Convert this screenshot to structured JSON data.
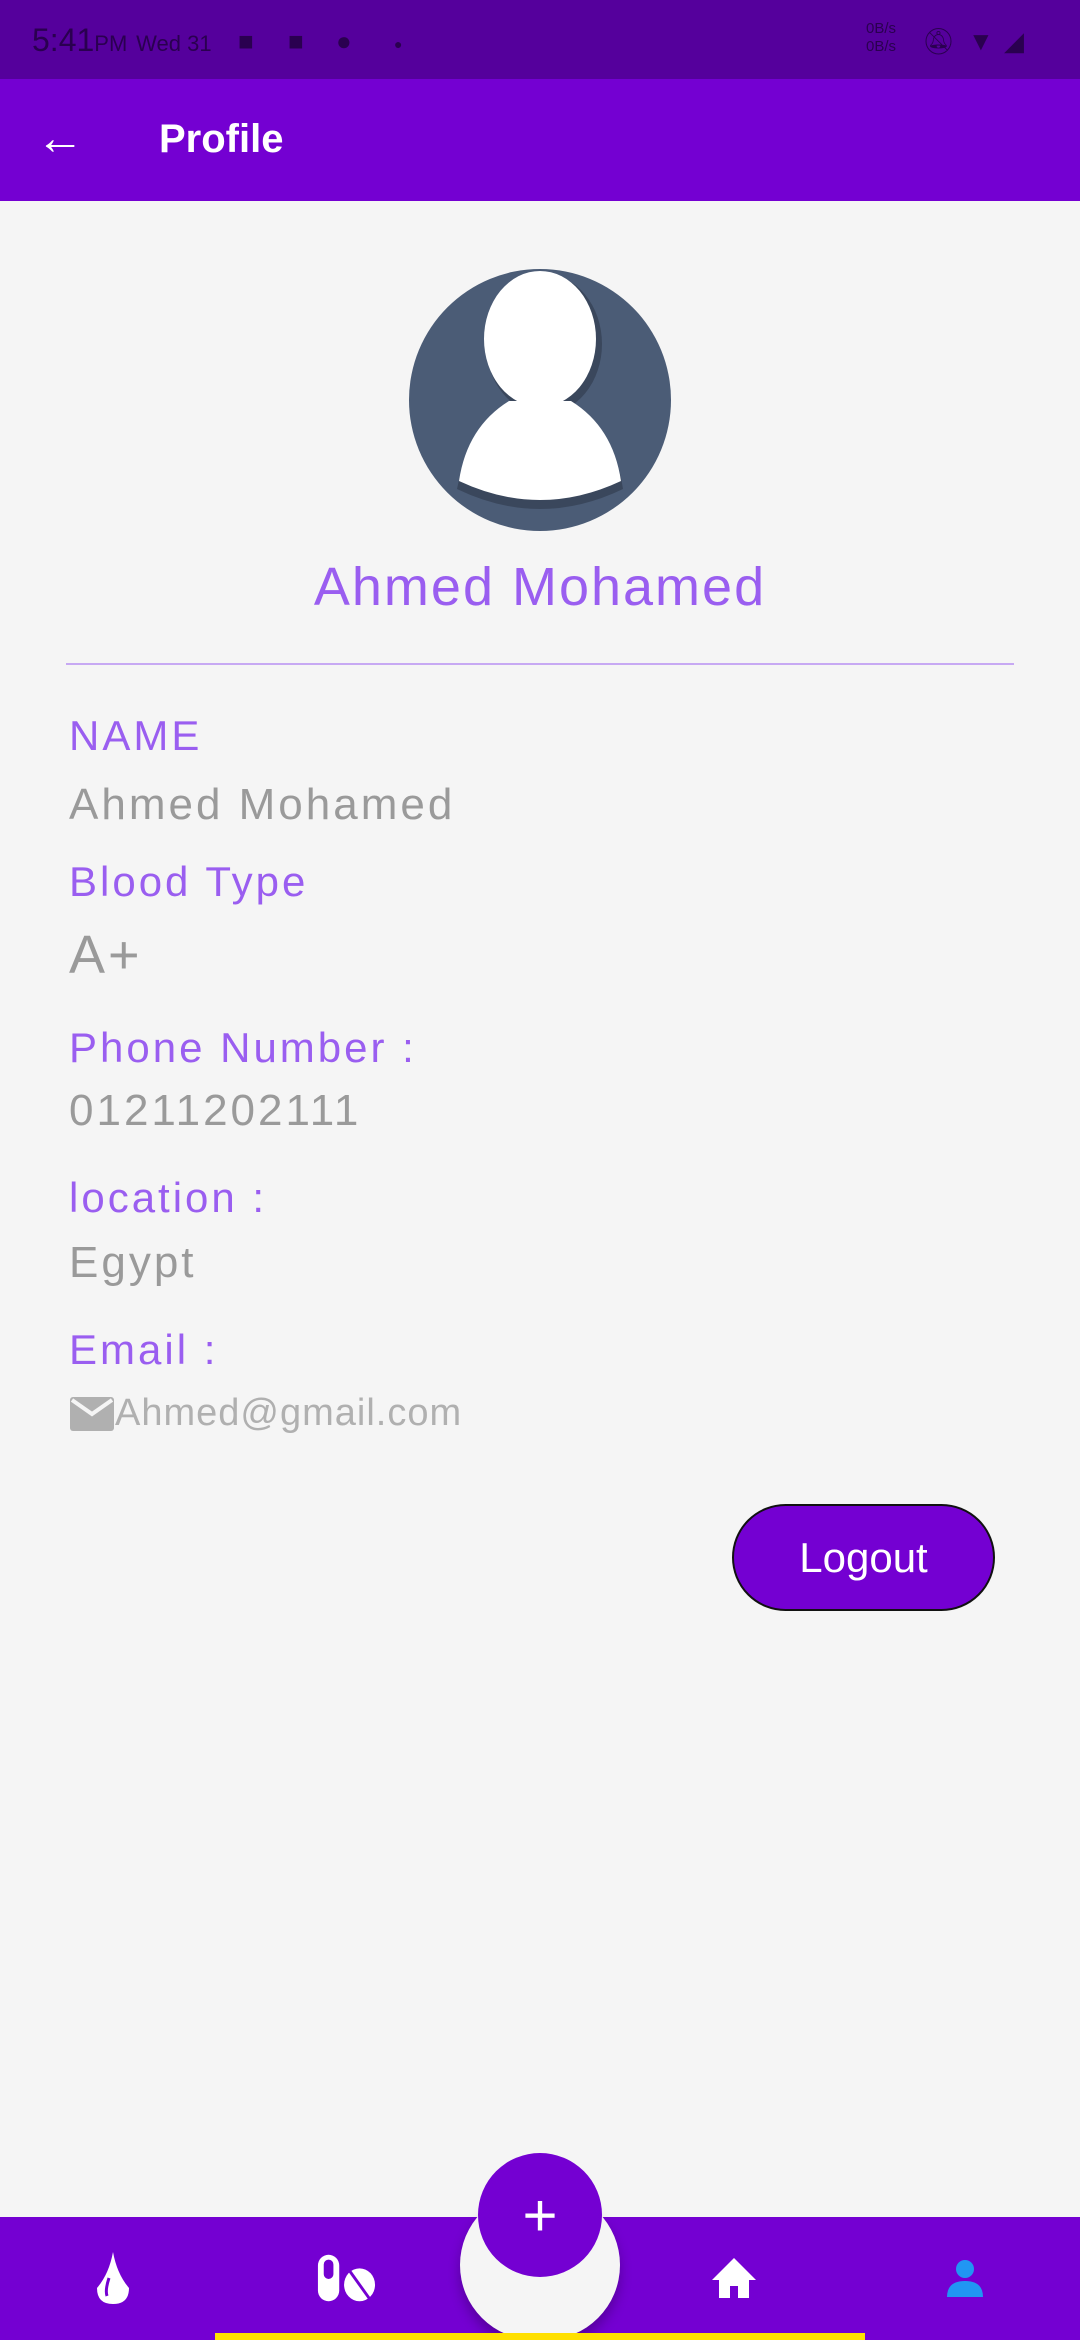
{
  "status_bar": {
    "time": "5:41",
    "ampm": "PM",
    "date": "Wed 31",
    "net_up": "0B/s",
    "net_down": "0B/s",
    "icons": [
      "discord-icon",
      "discord-icon",
      "reddit-icon",
      "dot-icon",
      "bell-off-icon",
      "wifi-icon",
      "signal-icon"
    ]
  },
  "app_bar": {
    "title": "Profile",
    "back_icon": "arrow-left-icon"
  },
  "profile": {
    "display_name": "Ahmed Mohamed"
  },
  "fields": [
    {
      "label": "NAME",
      "value": "Ahmed Mohamed"
    },
    {
      "label": "Blood Type",
      "value": "A+"
    },
    {
      "label": "Phone Number :",
      "value": "01211202111"
    },
    {
      "label": "location :",
      "value": "Egypt"
    },
    {
      "label": "Email :",
      "value": "Ahmed@gmail.com"
    }
  ],
  "logout_label": "Logout",
  "bottom_nav": {
    "fab_label": "+",
    "items": [
      "blood-drop-icon",
      "pills-icon",
      "home-icon",
      "person-icon"
    ],
    "active": "person-icon"
  },
  "colors": {
    "primary": "#7400d2",
    "accent_text": "#9a5ef0",
    "active_icon": "#2196f3",
    "indicator": "#ffe000"
  }
}
